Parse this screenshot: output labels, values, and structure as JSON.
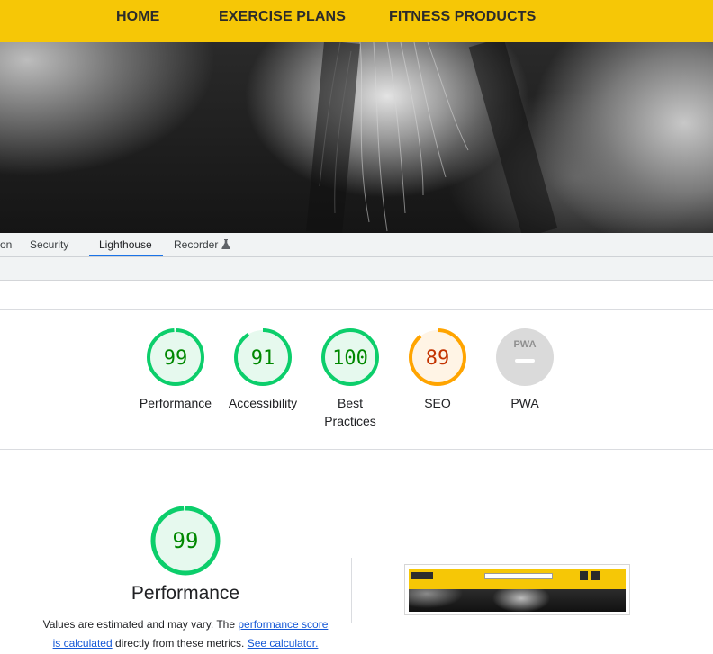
{
  "site_nav": {
    "items": [
      "HOME",
      "EXERCISE PLANS",
      "FITNESS PRODUCTS"
    ]
  },
  "devtools": {
    "tabs": [
      {
        "label": "on",
        "active": false
      },
      {
        "label": "Security",
        "active": false
      },
      {
        "label": "Lighthouse",
        "active": true
      },
      {
        "label": "Recorder",
        "active": false,
        "icon": "flask-icon"
      }
    ]
  },
  "lighthouse": {
    "categories": [
      {
        "score": "99",
        "label": "Performance",
        "value": 99,
        "status": "pass"
      },
      {
        "score": "91",
        "label": "Accessibility",
        "value": 91,
        "status": "pass"
      },
      {
        "score": "100",
        "label": "Best",
        "label2": "Practices",
        "value": 100,
        "status": "pass"
      },
      {
        "score": "89",
        "label": "SEO",
        "value": 89,
        "status": "average"
      },
      {
        "score": "",
        "label": "PWA",
        "value": 0,
        "status": "na",
        "badge": "PWA"
      }
    ],
    "performance": {
      "score": "99",
      "value": 99,
      "title": "Performance",
      "desc_prefix": "Values are estimated and may vary. The ",
      "link1_a": "performance score",
      "link1_b": "is calculated",
      "desc_mid": " directly from these metrics. ",
      "link2": "See calculator."
    }
  },
  "colors": {
    "pass_ring": "#0cce6b",
    "pass_fill": "#e6f9ee",
    "pass_text": "#008800",
    "average_ring": "#ffa400",
    "average_fill": "#fff4e5",
    "average_text": "#c33300",
    "na_fill": "#dadada",
    "nav_bg": "#f6c706",
    "accent": "#1a73e8"
  }
}
